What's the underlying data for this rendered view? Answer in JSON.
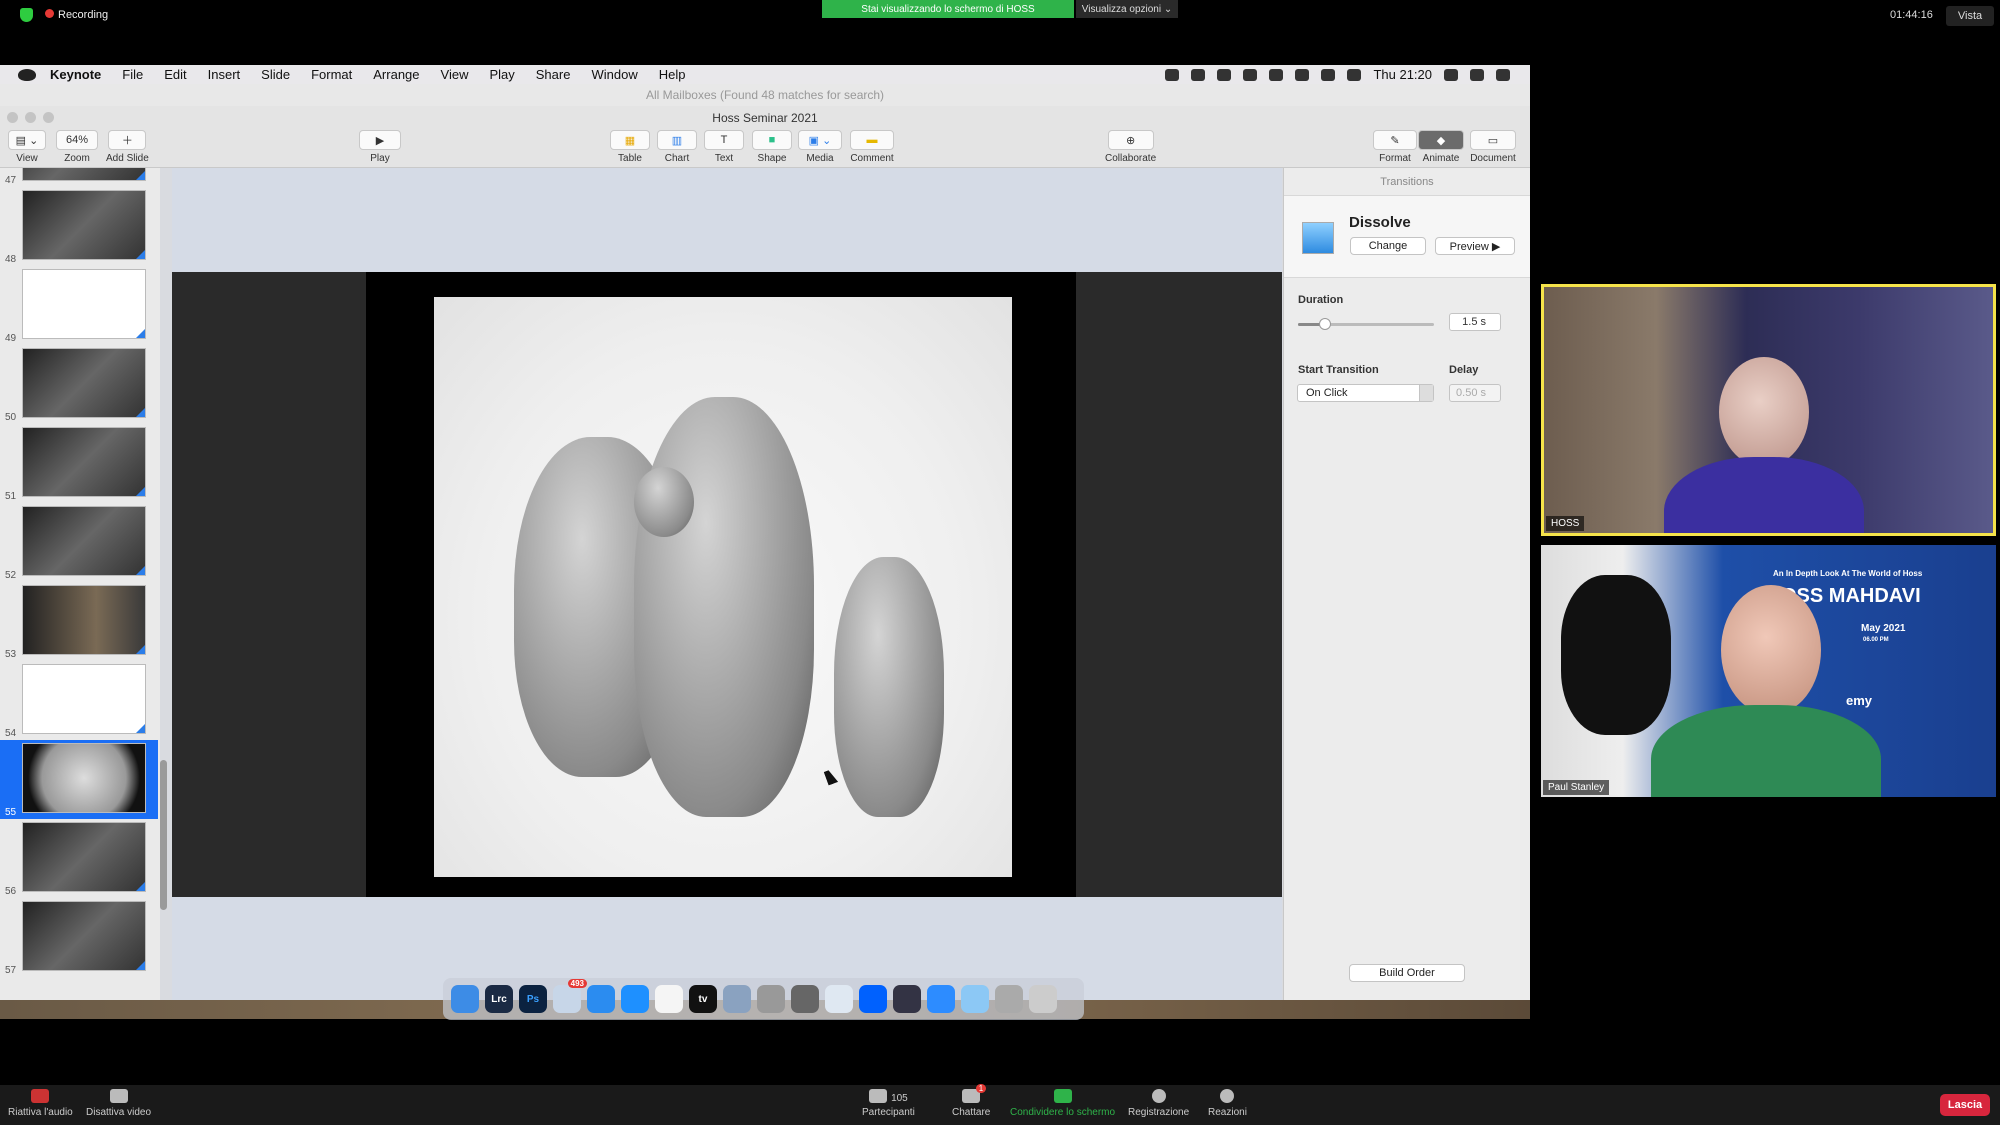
{
  "zoom_top": {
    "recording": "Recording",
    "share_banner": "Stai visualizzando lo schermo di HOSS",
    "view_options": "Visualizza opzioni ⌄",
    "time": "01:44:16",
    "view": "Vista"
  },
  "menubar": {
    "app": "Keynote",
    "items": [
      "File",
      "Edit",
      "Insert",
      "Slide",
      "Format",
      "Arrange",
      "View",
      "Play",
      "Share",
      "Window",
      "Help"
    ],
    "clock": "Thu 21:20"
  },
  "window": {
    "ghost_title": "All Mailboxes (Found 48 matches for search)",
    "title": "Hoss Seminar 2021"
  },
  "toolbar": {
    "view": "View",
    "zoom": "Zoom",
    "zoom_value": "64%",
    "add_slide": "Add Slide",
    "play": "Play",
    "table": "Table",
    "chart": "Chart",
    "text": "Text",
    "shape": "Shape",
    "media": "Media",
    "comment": "Comment",
    "collaborate": "Collaborate",
    "format": "Format",
    "animate": "Animate",
    "document": "Document"
  },
  "navigator": {
    "slides": [
      "47",
      "48",
      "49",
      "50",
      "51",
      "52",
      "53",
      "54",
      "55",
      "56",
      "57"
    ],
    "selected": "55"
  },
  "inspector": {
    "header": "Transitions",
    "effect": "Dissolve",
    "change": "Change",
    "preview": "Preview ▶",
    "duration_label": "Duration",
    "duration_value": "1.5 s",
    "duration_fraction": 0.2,
    "start_label": "Start Transition",
    "start_value": "On Click",
    "delay_label": "Delay",
    "delay_value": "0.50 s",
    "build_order": "Build Order"
  },
  "dock": {
    "apps": [
      "Finder",
      "Lrc",
      "Ps",
      "Mail",
      "App Store",
      "Safari",
      "Music",
      "tv",
      "Preview",
      "Utility",
      "System Preferences",
      "Keynote",
      "Dropbox",
      "QuickTime",
      "Zoom",
      "Folder",
      "Photos",
      "Trash"
    ],
    "mail_badge": "493"
  },
  "video": {
    "tile1_name": "HOSS",
    "tile2_name": "Paul Stanley",
    "poster_line1": "An In Depth Look At The World of Hoss",
    "poster_line2": "OSS MAHDAVI",
    "poster_date": "May 2021",
    "poster_time": "06.00 PM",
    "poster_partial": "emy"
  },
  "zoom_bottom": {
    "audio": "Riattiva l'audio",
    "video": "Disattiva video",
    "participants": "Partecipanti",
    "participants_count": "105",
    "chat": "Chattare",
    "chat_badge": "1",
    "share": "Condividere lo schermo",
    "record": "Registrazione",
    "reactions": "Reazioni",
    "leave": "Lascia"
  },
  "colors": {
    "accent": "#1a6ef5",
    "share_green": "#2fb34a",
    "leave_red": "#d7263d",
    "speaker_border": "#f5e34a"
  }
}
